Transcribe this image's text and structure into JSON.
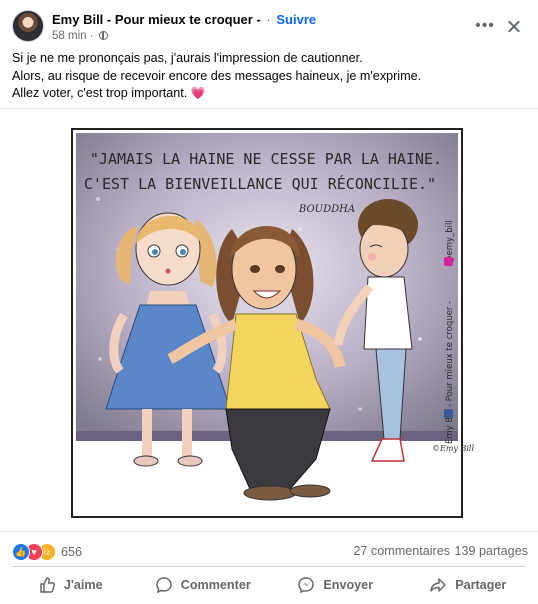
{
  "post": {
    "page_name": "Emy Bill - Pour mieux te croquer -",
    "separator": "·",
    "follow_label": "Suivre",
    "time": "58 min",
    "time_separator": "·",
    "visibility_icon": "globe-icon",
    "message_lines": [
      "Si je ne me prononçais pas, j'aurais l'impression de cautionner.",
      "Alors, au risque de recevoir encore des messages haineux, je m'exprime.",
      "Allez voter, c'est trop important."
    ],
    "message_emoji": "💗"
  },
  "illustration": {
    "quote_line1": "\"JAMAIS LA HAINE NE CESSE PAR LA HAINE.",
    "quote_line2": "C'EST LA BIENVEILLANCE QUI RÉCONCILIE.\"",
    "author": "BOUDDHA",
    "side_credit": "Emy Bill - Pour mieux te croquer -",
    "insta_handle": "@emy_bill",
    "signature": "©Emy Bill"
  },
  "stats": {
    "reaction_icons": [
      "like-icon",
      "love-icon",
      "care-icon"
    ],
    "reaction_count": "656",
    "comments": "27 commentaires",
    "shares": "139 partages"
  },
  "actions": {
    "like": "J'aime",
    "comment": "Commenter",
    "send": "Envoyer",
    "share": "Partager"
  },
  "colors": {
    "accent": "#0866ff",
    "secondary_text": "#65676b",
    "illustration_bg": "#c9bdd2",
    "floor": "#8f7fa6",
    "mom_top": "#f2d55e",
    "girl_dress": "#5b86c8"
  }
}
